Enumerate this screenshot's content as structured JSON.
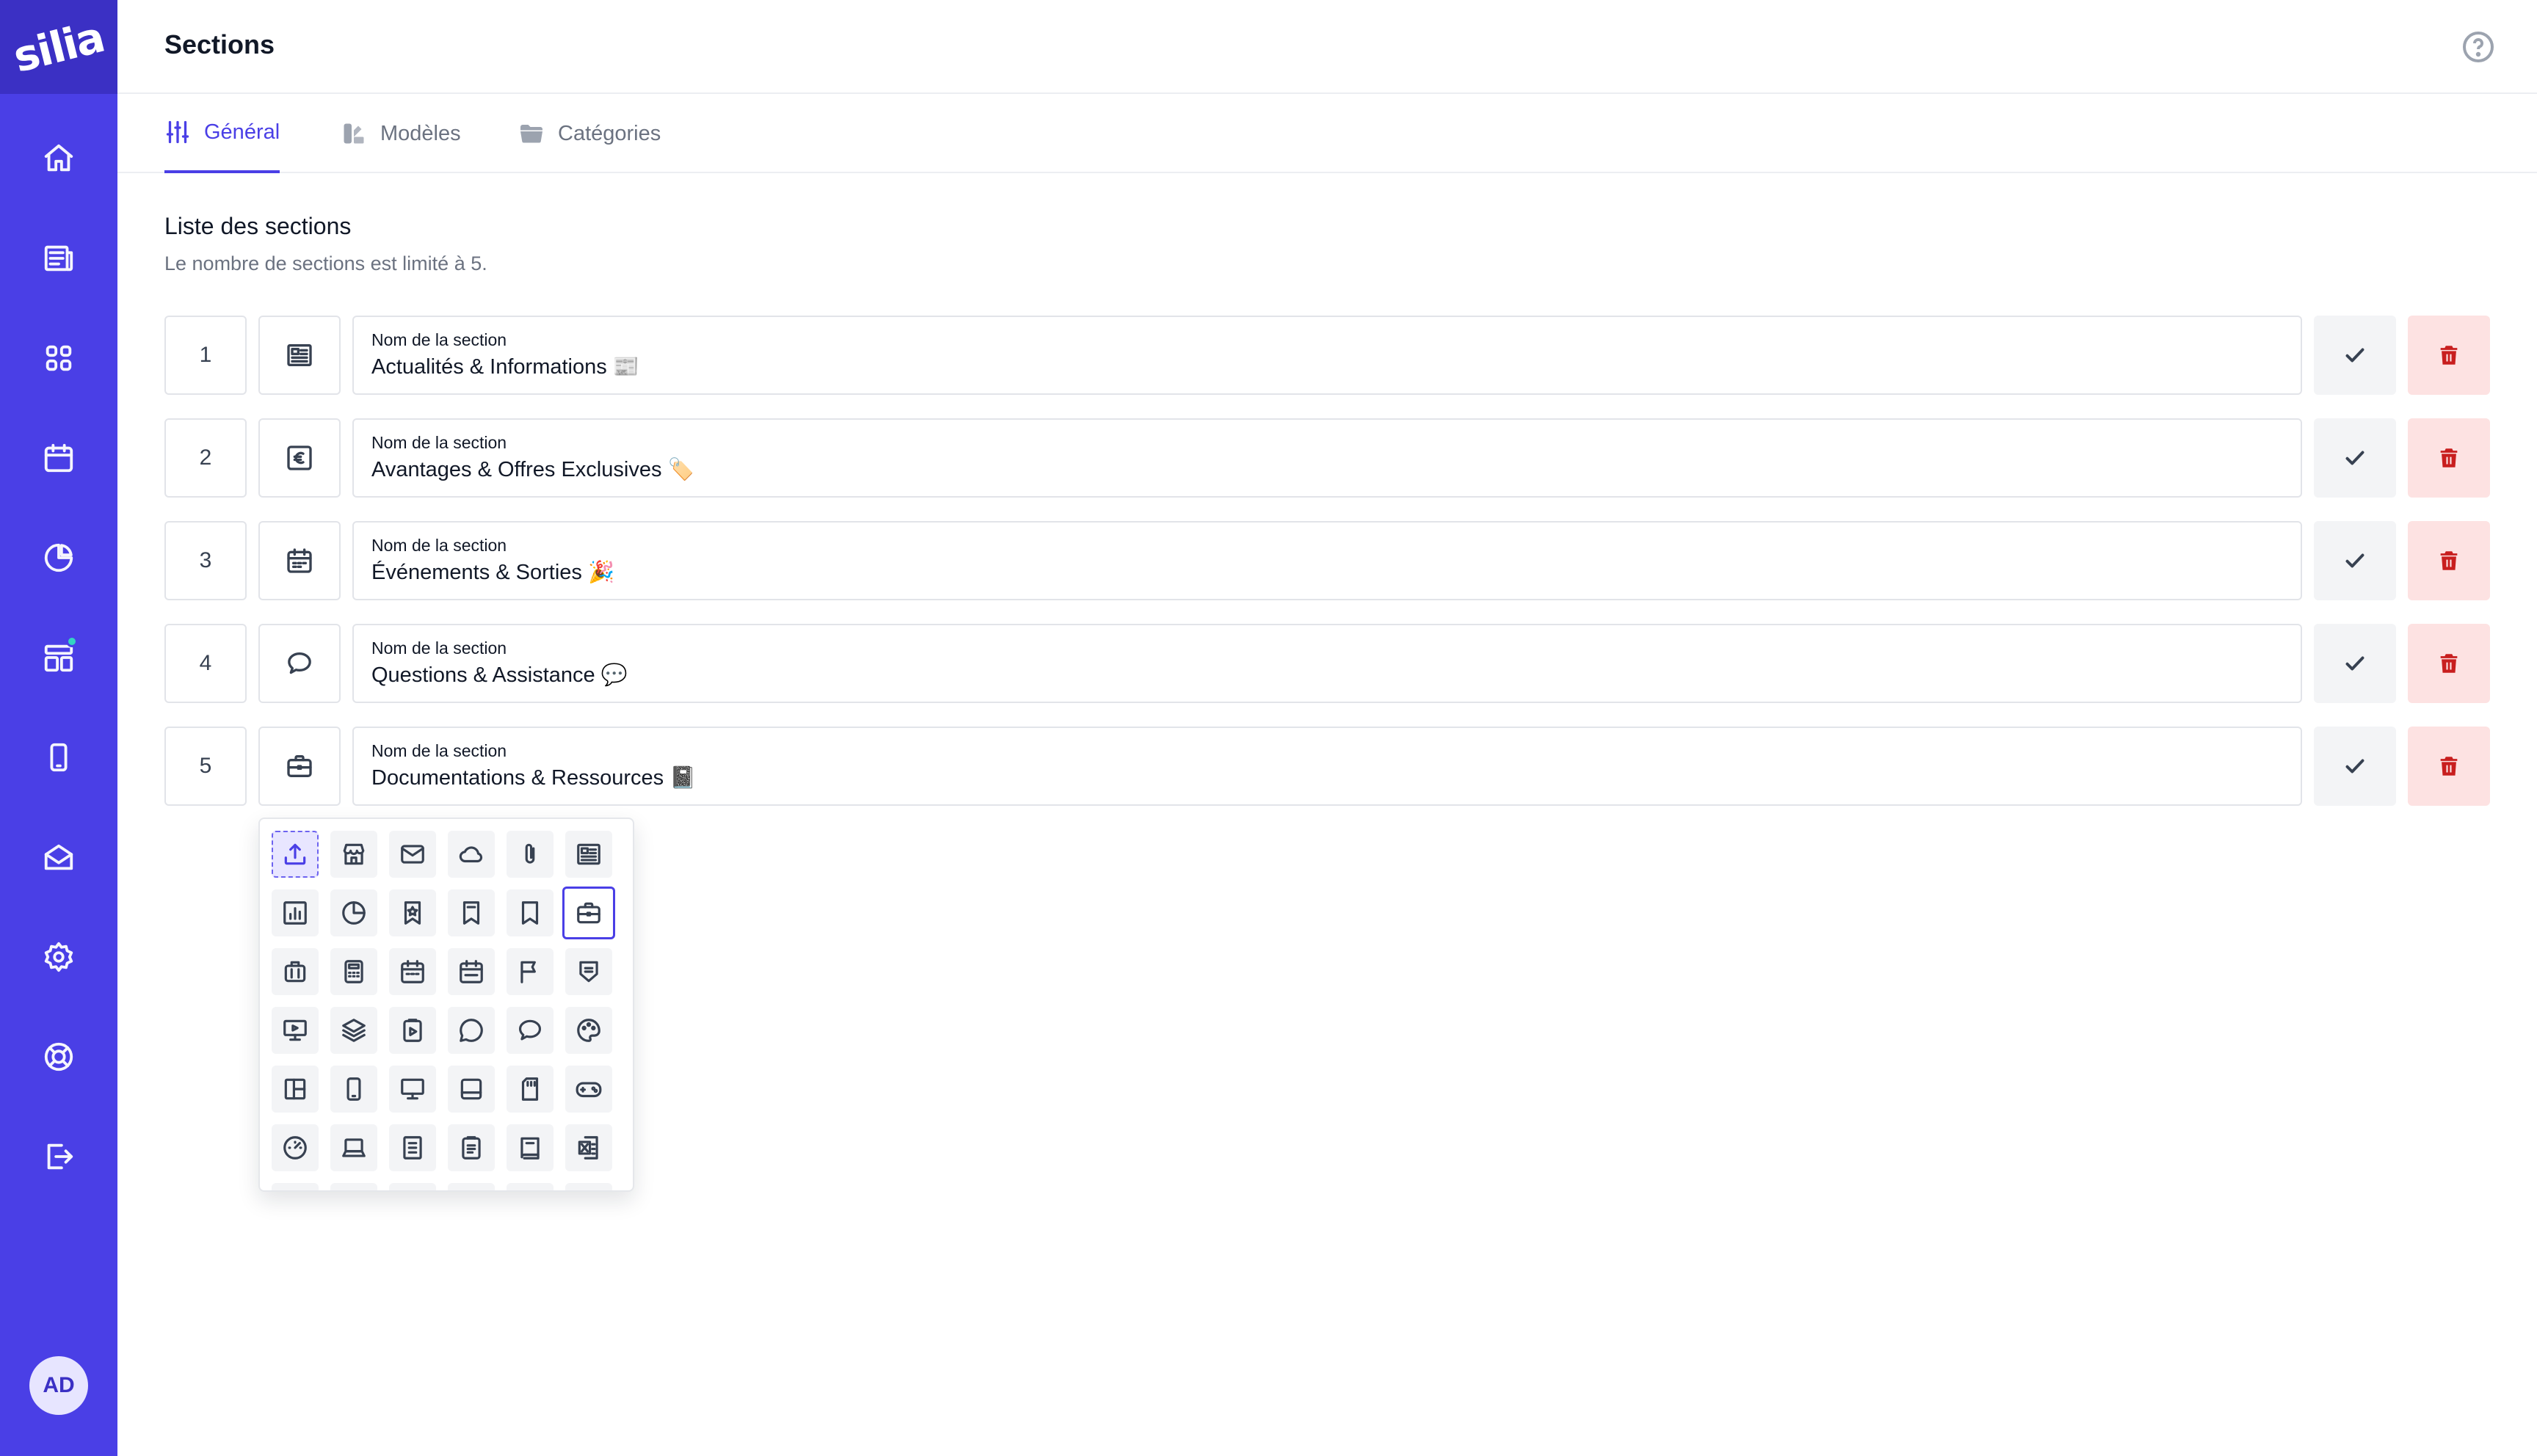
{
  "app": {
    "logo_text": "silia"
  },
  "sidebar": {
    "icons": [
      "home-icon",
      "news-icon",
      "grid-icon",
      "calendar-icon",
      "pie-chart-icon",
      "layout-icon",
      "phone-icon",
      "mail-icon",
      "gear-icon",
      "lifebuoy-icon",
      "logout-icon"
    ],
    "badge_color": "#34d3c3",
    "avatar_initials": "AD"
  },
  "header": {
    "title": "Sections",
    "help_icon": "help-circle-icon"
  },
  "tabs": [
    {
      "label": "Général",
      "icon": "sliders-icon",
      "active": true
    },
    {
      "label": "Modèles",
      "icon": "palette-icon",
      "active": false
    },
    {
      "label": "Catégories",
      "icon": "folder-icon",
      "active": false
    }
  ],
  "section_list": {
    "title": "Liste des sections",
    "subtitle": "Le nombre de sections est limité à 5.",
    "field_label": "Nom de la section",
    "rows": [
      {
        "number": "1",
        "icon": "newspaper-icon",
        "name": "Actualités & Informations 📰"
      },
      {
        "number": "2",
        "icon": "euro-icon",
        "name": "Avantages & Offres Exclusives 🏷️"
      },
      {
        "number": "3",
        "icon": "calendar-icon",
        "name": "Événements & Sorties 🎉"
      },
      {
        "number": "4",
        "icon": "chat-bubble-icon",
        "name": "Questions & Assistance 💬"
      },
      {
        "number": "5",
        "icon": "briefcase-icon",
        "name": "Documentations & Ressources 📓"
      }
    ]
  },
  "icon_picker": {
    "selected": "briefcase-icon",
    "icons": [
      "upload-icon",
      "store-icon",
      "mail-icon",
      "cloud-icon",
      "paperclip-icon",
      "newspaper-icon",
      "bar-chart-icon",
      "pie-chart-icon",
      "bookmark-star-icon",
      "bookmarks-icon",
      "bookmark-icon",
      "briefcase-icon",
      "luggage-icon",
      "calculator-icon",
      "calendar-icon",
      "calendar-range-icon",
      "flag-icon",
      "shield-list-icon",
      "presentation-icon",
      "layers-icon",
      "clipboard-play-icon",
      "chat-circle-icon",
      "chat-bubble-icon",
      "palette-icon",
      "layout-panel-icon",
      "smartphone-icon",
      "monitor-icon",
      "tablet-icon",
      "sd-card-icon",
      "gamepad-icon",
      "gauge-icon",
      "laptop-icon",
      "document-icon",
      "clipboard-list-icon",
      "book-icon",
      "excel-file-icon"
    ]
  },
  "colors": {
    "primary": "#4a3fe6",
    "primary_dark": "#3b30c4",
    "danger": "#c81e1e",
    "danger_bg": "#fde2e2"
  }
}
